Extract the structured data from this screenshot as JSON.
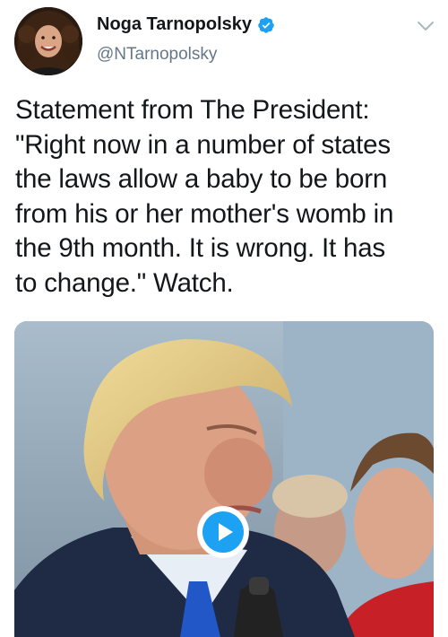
{
  "author": {
    "display_name": "Noga Tarnopolsky",
    "handle": "@NTarnopolsky",
    "verified": true,
    "avatar_icon": "profile-photo"
  },
  "menu_icon": "chevron-down-icon",
  "tweet": {
    "lines": [
      "Statement from The President:",
      "\"Right now in a number of states",
      "the laws allow a baby to be born",
      "from his or her mother's womb in",
      "the 9th month. It is wrong. It has",
      "to change.\" Watch."
    ]
  },
  "media": {
    "type": "video",
    "play_icon": "play-icon"
  },
  "colors": {
    "accent": "#1da1f2",
    "text": "#14171a",
    "secondary": "#657786"
  }
}
